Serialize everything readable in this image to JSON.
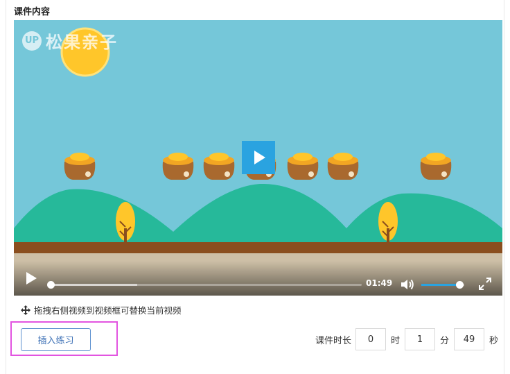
{
  "section": {
    "title": "课件内容"
  },
  "video": {
    "watermark_text": "松果亲子",
    "watermark_logo": "UP",
    "time": "01:49",
    "progress": 0.0,
    "volume": 0.88
  },
  "icons": {
    "play": "play-icon",
    "volume": "volume-icon",
    "fullscreen": "fullscreen-icon",
    "move": "move-icon"
  },
  "hint": {
    "text": "拖拽右侧视频到视频框可替换当前视频"
  },
  "actions": {
    "insert_label": "插入练习"
  },
  "duration": {
    "label": "课件时长",
    "hours": "0",
    "hours_unit": "时",
    "minutes": "1",
    "minutes_unit": "分",
    "seconds": "49",
    "seconds_unit": "秒"
  },
  "colors": {
    "sky": "#75c7d9",
    "hill": "#26b99a",
    "ground": "#8a4e1e",
    "sun": "#ffc62a",
    "accent": "#2aa3e0",
    "highlight": "#e254e0"
  }
}
